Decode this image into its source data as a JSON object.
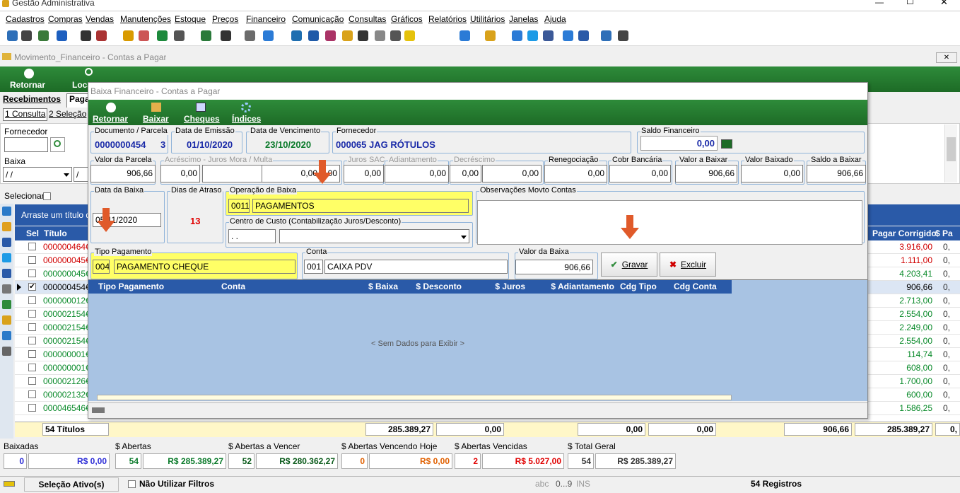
{
  "app": {
    "title": "Gestão Administrativa"
  },
  "menu": [
    "Cadastros",
    "Compras",
    "Vendas",
    "Manutenções",
    "Estoque",
    "Preços",
    "Financeiro",
    "Comunicação",
    "Consultas",
    "Gráficos",
    "Relatórios",
    "Utilitários",
    "Janelas",
    "Ajuda"
  ],
  "child": {
    "title": "Movimento_Financeiro - Contas a Pagar",
    "tb": [
      "Retornar",
      "Loca"
    ],
    "tabs": [
      "Recebimentos",
      "Paga"
    ],
    "subtabs": [
      "1 Consulta",
      "2 Seleção"
    ],
    "filter": {
      "fornecedor_label": "Fornecedor",
      "baixa_label": "Baixa",
      "date1": " / /",
      "date2": "/",
      "selecionar": "Selecionar"
    },
    "groupbar": "Arraste um título de",
    "cols": [
      "Sel",
      "Título"
    ],
    "rcols": [
      "Pagar Corrigido",
      "$ Pa"
    ],
    "rows": [
      {
        "t": "000000464€",
        "v": "3.916,00",
        "c": "red"
      },
      {
        "t": "000000045€",
        "v": "1.111,00",
        "c": "red"
      },
      {
        "t": "000000045€",
        "v": "4.203,41",
        "c": "green"
      },
      {
        "t": "000000454€",
        "v": "906,66",
        "c": "black",
        "sel": true
      },
      {
        "t": "000000012€",
        "v": "2.713,00",
        "c": "green"
      },
      {
        "t": "000002154€",
        "v": "2.554,00",
        "c": "green"
      },
      {
        "t": "000002154€",
        "v": "2.249,00",
        "c": "green"
      },
      {
        "t": "000002154€",
        "v": "2.554,00",
        "c": "green"
      },
      {
        "t": "000000001€",
        "v": "114,74",
        "c": "green"
      },
      {
        "t": "000000001€",
        "v": "608,00",
        "c": "green"
      },
      {
        "t": "000002126€",
        "v": "1.700,00",
        "c": "green"
      },
      {
        "t": "000002132€",
        "v": "600,00",
        "c": "green"
      },
      {
        "t": "000046546€",
        "v": "1.586,25",
        "c": "green"
      }
    ],
    "footer": {
      "count": "54 Títulos",
      "v1": "285.389,27",
      "v2": "0,00",
      "v3": "0,00",
      "v4": "0,00",
      "v5": "906,66",
      "v6": "285.389,27",
      "v7": "0,"
    },
    "summary": [
      {
        "label": "Baixadas",
        "n": "0",
        "v": "R$ 0,00",
        "nc": "#2b2bd6",
        "vc": "#2b2bd6"
      },
      {
        "label": "$ Abertas",
        "n": "54",
        "v": "R$ 285.389,27",
        "nc": "#0a7a2a",
        "vc": "#0a7a2a"
      },
      {
        "label": "$ Abertas a Vencer",
        "n": "52",
        "v": "R$ 280.362,27",
        "nc": "#0a5a1a",
        "vc": "#0a5a1a"
      },
      {
        "label": "$ Abertas Vencendo Hoje",
        "n": "0",
        "v": "R$ 0,00",
        "nc": "#e06000",
        "vc": "#e06000"
      },
      {
        "label": "$ Abertas Vencidas",
        "n": "2",
        "v": "R$ 5.027,00",
        "nc": "#e00000",
        "vc": "#e00000"
      },
      {
        "label": "$ Total Geral",
        "n": "54",
        "v": "R$ 285.389,27",
        "nc": "#333",
        "vc": "#333"
      }
    ],
    "status": {
      "sel": "Seleção Ativo(s)",
      "nofilter": "Não Utilizar Filtros",
      "abc": "abc",
      "n09": "0...9",
      "ins": "INS",
      "reg": "54 Registros"
    }
  },
  "dialog": {
    "title": "Baixa Financeiro - Contas a Pagar",
    "tb": [
      "Retornar",
      "Baixar",
      "Cheques",
      "Índices"
    ],
    "doc_label": "Documento / Parcela",
    "doc": "0000000454",
    "parcela": "3",
    "emissao_label": "Data de Emissão",
    "emissao": "01/10/2020",
    "venc_label": "Data de Vencimento",
    "venc": "23/10/2020",
    "forn_label": "Fornecedor",
    "forn": "000065 JAG RÓTULOS",
    "saldo_label": "Saldo Financeiro",
    "saldo": "0,00",
    "valparc_label": "Valor da Parcela",
    "valparc": "906,66",
    "acres_label": "Acréscimo - Juros Mora / Multa",
    "acres1": "0,00",
    "acres2": "0,00",
    "jsac_label": "Juros SAC",
    "jsac": "0,00",
    "adiant_label": "Adiantamento",
    "adiant": "0,00",
    "decres_label": "Decréscimo",
    "decres1": "0,00",
    "decres2": "0,00",
    "reneg_label": "Renegociação",
    "reneg": "0,00",
    "cobr_label": "Cobr Bancária",
    "cobr": "0,00",
    "vab_label": "Valor a Baixar",
    "vab": "906,66",
    "vbx_label": "Valor Baixado",
    "vbx": "0,00",
    "sab_label": "Saldo a Baixar",
    "sab": "906,66",
    "dtb_label": "Data da Baixa",
    "dtb": "05/11/2020",
    "dias_label": "Dias de Atraso",
    "dias": "13",
    "op_label": "Operação de Baixa",
    "op_code": "0011",
    "op": "PAGAMENTOS",
    "cc_label": "Centro de Custo (Contabilização Juros/Desconto)",
    "cc_code": " .  .",
    "obs_label": "Observações Movto Contas",
    "tp_label": "Tipo Pagamento",
    "tp_code": "004",
    "tp": "PAGAMENTO CHEQUE",
    "conta_label": "Conta",
    "conta_code": "001",
    "conta": "CAIXA PDV",
    "vb_label": "Valor da Baixa",
    "vb": "906,66",
    "gravar": "Gravar",
    "excluir": "Excluir",
    "grid_cols": [
      "Tipo Pagamento",
      "Conta",
      "$ Baixa",
      "$ Desconto",
      "$ Juros",
      "$ Adiantamento",
      "Cdg Tipo",
      "Cdg Conta"
    ],
    "empty": "< Sem Dados para Exibir >"
  },
  "colors": {
    "green": "#1f7a2b",
    "blue": "#2a5aa8",
    "highlight": "#ffff66",
    "arrow": "#e05a2a"
  }
}
